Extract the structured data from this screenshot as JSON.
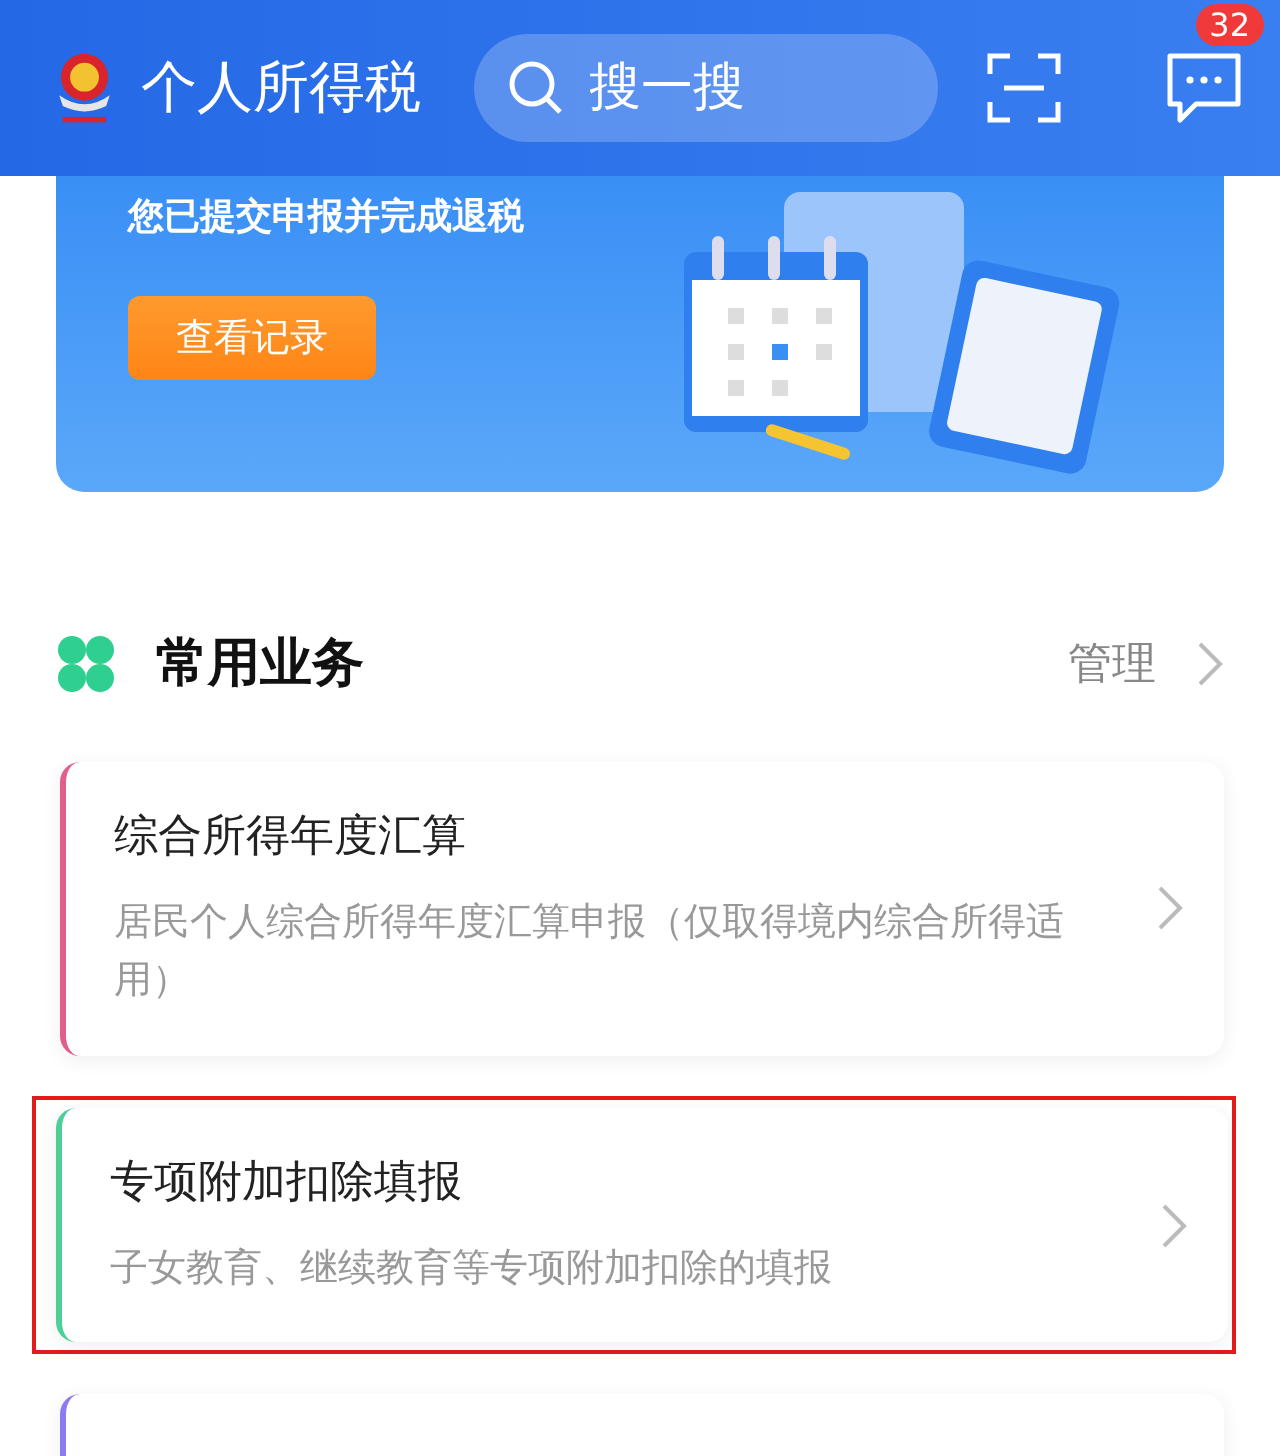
{
  "header": {
    "title": "个人所得税",
    "search": {
      "placeholder": "搜一搜"
    },
    "message_badge": "32"
  },
  "banner": {
    "text": "您已提交申报并完成退税",
    "button": "查看记录"
  },
  "section": {
    "title": "常用业务",
    "manage": "管理"
  },
  "services": [
    {
      "title": "综合所得年度汇算",
      "desc": "居民个人综合所得年度汇算申报（仅取得境内综合所得适用）",
      "color": "#e0608a",
      "highlighted": false
    },
    {
      "title": "专项附加扣除填报",
      "desc": "子女教育、继续教育等专项附加扣除的填报",
      "color": "#4ccf98",
      "highlighted": true
    },
    {
      "color": "#8a7cf0",
      "highlighted": false
    }
  ]
}
